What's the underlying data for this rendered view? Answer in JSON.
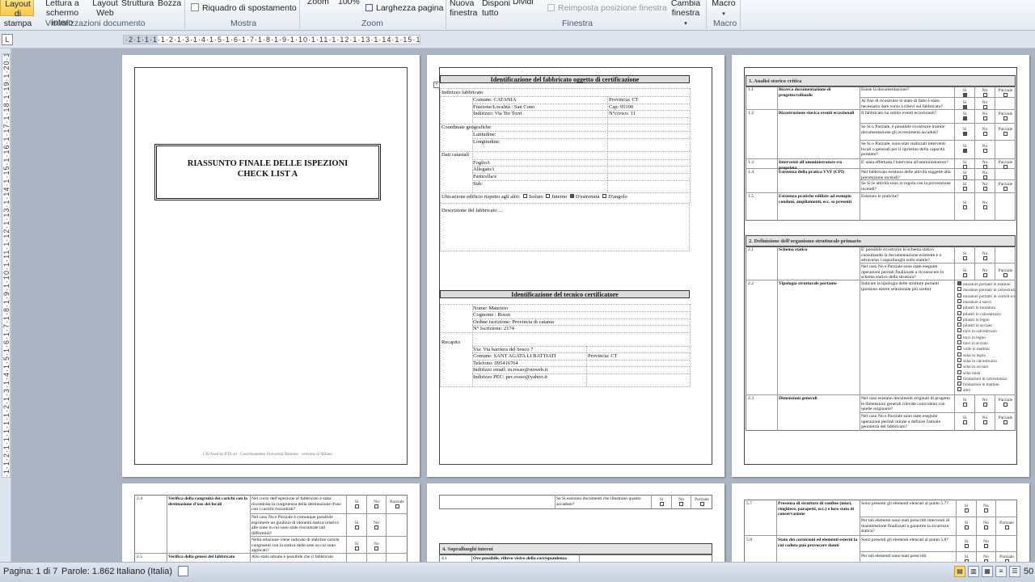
{
  "ribbon": {
    "layout_print": "Layout di stampa",
    "full_screen": "Lettura a schermo intero",
    "web_layout": "Layout Web",
    "outline": "Struttura",
    "draft": "Bozza",
    "views_group": "Visualizzazioni documento",
    "nav_pane": "Riquadro di spostamento",
    "show_group": "Mostra",
    "zoom": "Zoom",
    "zoom_100": "100%",
    "page_width": "Larghezza pagina",
    "zoom_group": "Zoom",
    "new_window": "Nuova finestra",
    "arrange_all": "Disponi tutto",
    "split": "Dividi",
    "reset_position": "Reimposta posizione finestra",
    "window_group": "Finestra",
    "switch_windows": "Cambia finestra",
    "macro": "Macro",
    "macro_group": "Macro"
  },
  "ruler": {
    "h_text": "·2·1·1·1·1·2·1·3·1·4·1·5·1·6·1·7·1·8·1·9·1·10·1·11·1·12·1·13·1·14·1·15·1·16·1·17·1·18",
    "v_text": "·1·1·2·1·1·1·1·1·2·1·3·1·4·1·5·1·6·1·7·1·8·1·9·1·10·1·11·1·12·1·13·1·14·1·15·1·16·1·17·1·18·1·19·1·20·1·21·1·22·1·23·1·24·1·25·1·26·1·27·1·28",
    "tab_selector": "L"
  },
  "page1": {
    "title_line1": "RIASSUNTO FINALE DELLE ISPEZIONI",
    "title_line2": "CHECK LIST A",
    "footer": "CIS Nord by ETS srl · Coordinamento Università Dalmine · versione di Milano"
  },
  "page2": {
    "section1": "Identificazione del fabbricato oggetto di certificazione",
    "address_label": "Indirizzo fabbricato",
    "comune": "Comune: CATANIA",
    "provincia": "Provincia: CT",
    "frazione": "Frazione/Località : San Cono",
    "cap": "Cap:   95100",
    "indirizzo": "Indirizzo: Via Tre Torri",
    "civico": "N°civico: 11",
    "coord_label": "Coordinate geografiche",
    "latitudine": "Latitudine:",
    "longitudine": "Longitudine:",
    "catastali_label": "Dati catastali",
    "foglio": "Foglio/i",
    "allegato": "Allegato/i",
    "particella": "Particella/e",
    "sub": "Sub:",
    "ubicazione": "Ubicazione edificio rispetto agli altri:",
    "isolato": "Isolato",
    "interno": "Interno",
    "estremita": "D'estremità",
    "angolo": "D'angolo",
    "descrizione": "Descrizione del fabbricato ...",
    "section2": "Identificazione del tecnico certificatore",
    "nome": "Nome: Maurizio",
    "cognome": "Cognome : Rosso",
    "ordine": "Ordine iscrizione: Provincia di catania",
    "iscrizione": "N° Iscrizione: 2174",
    "recapito": "Recapito",
    "via": "Via: Via barriera del bosco 7",
    "comune2": "Comune: SANT AGATA LI BATTIATI",
    "provincia2": "Provincia: CT",
    "telefono": "Telefono: 095416764",
    "email": "Indirizzo email: m.rosso@stsweb.it",
    "pec": "Indirizzo PEC: pec.rosso@yahoo.it"
  },
  "page3": {
    "sec1": "1. Analisi storico critica",
    "r11_num": "1.1",
    "r11_title": "Ricerca documentazione di progetto/collaudo",
    "r11_q1": "Esiste la documentazione?",
    "r11_q2": "Ai fine di ricostruire lo stato di fatto è stato necessario dare corso a rilievi sul fabbricato?",
    "r12_num": "1.2",
    "r12_title": "Ricostruzione storica eventi eccezionali",
    "r12_q1": "Il fabbricato ha subito eventi eccezionali?",
    "r12_q2": "Se Si o Parziale, è possibile ricostruire tramite documentazione gli avvenimenti accaduti?",
    "r12_q3": "Se Si o Parziale, sono stati realizzati interventi locali o generali per il ripristino della capacità portante?",
    "r13_num": "1.3",
    "r13_title": "Interventi all'amministratore e/o proprieta",
    "r13_q1": "E' stata effettuata l'intervista all'amministratore?",
    "r14_num": "1.4",
    "r14_title": "Esistenza della pratica VVF (CPI)",
    "r14_q1": "Nel fabbricato esistono delle attività soggette alla prevenzione incendi?",
    "r14_q2": "Se Si le attività sono in regola con la prevenzione incendi?",
    "r15_num": "1.5",
    "r15_title": "Esistenza pratiche edilizie ad esempio condoni, ampliamenti, ecc. se presenti",
    "r15_q1": "Esistono le pratiche?",
    "sec2": "2. Definizione dell'organismo strutturale primario",
    "r21_num": "2.1",
    "r21_title": "Schema statico",
    "r21_q1": "E' possibile ricostruire lo schema statico consultando la documentazione esistente e o attraverso i sopralluoghi sullo stabile?",
    "r21_q2": "Nel caso No e Parziale sono state eseguite operazioni peritali finalizzate a riconoscere lo schema statico della struttura?",
    "r22_num": "2.2",
    "r22_title": "Tipologia strutturale portante",
    "r22_q1": "Indicare la tipologia delle strutture portanti (possono essere selezionate più scelte)",
    "r22_opts": [
      "murature portanti in mattoni",
      "murature portanti in calcestruzzo",
      "murature portanti in ciottoli e/o pietrame",
      "murature a sacco",
      "pilastri in muratura",
      "pilastri in calcestruzzo",
      "pilastri in legno",
      "pilastri in acciaio",
      "travi in calcestruzzo",
      "travi in legno",
      "travi in acciaio",
      "volte in mattoni",
      "solai in legno",
      "solai in calcestruzzo",
      "solai in acciaio",
      "solai misti",
      "fondazioni in calcestruzzo",
      "fondazioni in mattoni",
      "altro"
    ],
    "r23_num": "2.3",
    "r23_title": "Dimensioni generali",
    "r23_q1": "Nel caso esistano documenti originali di progetto le dimensioni generali rilevate coincidono con quelle originarie?",
    "r23_q2": "Nel caso No e Parziale sono state eseguite operazioni peritali mirate a definire l'attuale geometria del fabbricato?",
    "si": "Si",
    "no": "No",
    "parziale": "Parziale"
  },
  "page4": {
    "r24_num": "2.4",
    "r24_title": "Verifica della congruità dei carichi con la destinazione d'uso dei locali",
    "r24_q1": "Nel corso dell'ispezione al fabbricato è stata riscontrata la congruenza della destinazione d'uso con i carichi riscontrati?",
    "r24_q2": "Nel caso No e Parziale è comunque possibile esprimere un giudizio di idoneità statica relativo alle zone in cui sono state riscontrate tali difformità?",
    "r24_q3": "Nella relazione viene indicato di stabilire carichi congruenti con la statica delle aree su cui sono applicati?",
    "r25_num": "2.5",
    "r25_title": "Verifica della genesi del fabbricato",
    "r25_q1": "Allo stato attuale è possibile che il fabbricato"
  },
  "page5": {
    "q_top": "Se Si esistono documenti che illustrano quanto accaduto?",
    "sec4": "4. Sopralluoghi interni",
    "r41_num": "4.1",
    "r41_title": "Ove possibile, rilievo visivo della corrispondenza"
  },
  "page6": {
    "r57_num": "5.7",
    "r57_title": "Presenza di strutture di confine (muri, ringhiere, parapetti, ecc.) e loro stato di conservazione",
    "r57_q1": "Sono presenti gli elementi elencati al punto 5.7?",
    "r57_q2": "Per tali elementi sono stati prescritti interventi di manutenzione finalizzati a garantire la sicurezza statica?",
    "r58_num": "5.8",
    "r58_title": "Stato dei cornicioni ed elementi esterni la cui caduta può provocare danni",
    "r58_q1": "Sono presenti gli elementi elencati al punto 5.8?",
    "r58_q2": "Per tali elementi sono stati prescritti"
  },
  "status": {
    "page": "Pagina: 1 di 7",
    "words": "Parole: 1.862",
    "language": "Italiano (Italia)",
    "zoom": "50"
  }
}
